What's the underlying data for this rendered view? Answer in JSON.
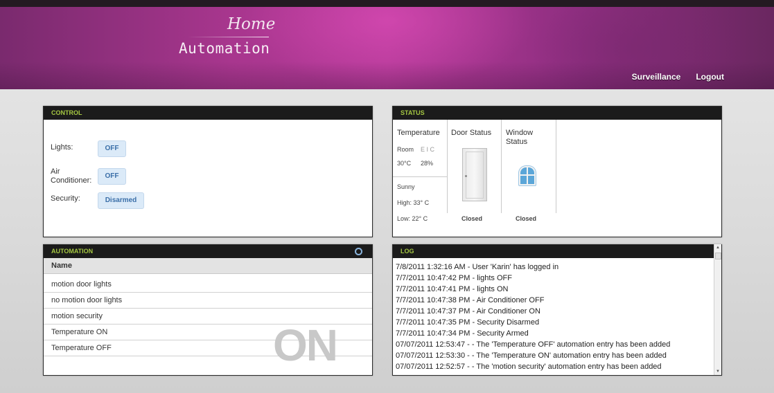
{
  "header": {
    "logo_home": "Home",
    "logo_automation": "Automation",
    "nav": {
      "surveillance": "Surveillance",
      "logout": "Logout"
    }
  },
  "control": {
    "title": "CONTROL",
    "rows": [
      {
        "label": "Lights:",
        "button": "OFF"
      },
      {
        "label": "Air",
        "label2": "Conditioner:",
        "button": "OFF"
      },
      {
        "label": "Security:",
        "button": "Disarmed"
      }
    ]
  },
  "status": {
    "title": "STATUS",
    "temperature": {
      "heading": "Temperature",
      "room_label": "Room",
      "room_code": "E I C",
      "temp": "30°C",
      "humidity": "28%",
      "weather": "Sunny",
      "high": "High: 33° C",
      "low": "Low: 22° C"
    },
    "door": {
      "heading": "Door Status",
      "state": "Closed"
    },
    "window": {
      "heading": "Window",
      "heading2": "Status",
      "state": "Closed"
    }
  },
  "automation": {
    "title": "AUTOMATION",
    "column": "Name",
    "rows": [
      "motion door lights",
      "no motion door lights",
      "motion security",
      "Temperature ON",
      "Temperature OFF"
    ],
    "overlay": "ON"
  },
  "log": {
    "title": "LOG",
    "lines": [
      "7/8/2011 1:32:16 AM - User 'Karin' has logged in",
      "7/7/2011 10:47:42 PM - lights OFF",
      "7/7/2011 10:47:41 PM - lights ON",
      "7/7/2011 10:47:38 PM - Air Conditioner OFF",
      "7/7/2011 10:47:37 PM - Air Conditioner ON",
      "7/7/2011 10:47:35 PM - Security Disarmed",
      "7/7/2011 10:47:34 PM - Security Armed",
      "07/07/2011 12:53:47 - - The 'Temperature OFF' automation entry has been added",
      "07/07/2011 12:53:30 - - The 'Temperature ON' automation entry has been added",
      "07/07/2011 12:52:57 - - The 'motion security' automation entry has been added"
    ]
  },
  "colors": {
    "accent_green": "#a5c742",
    "button_bg": "#dbeaf8",
    "panel_title_bg": "#1b1b1b"
  }
}
